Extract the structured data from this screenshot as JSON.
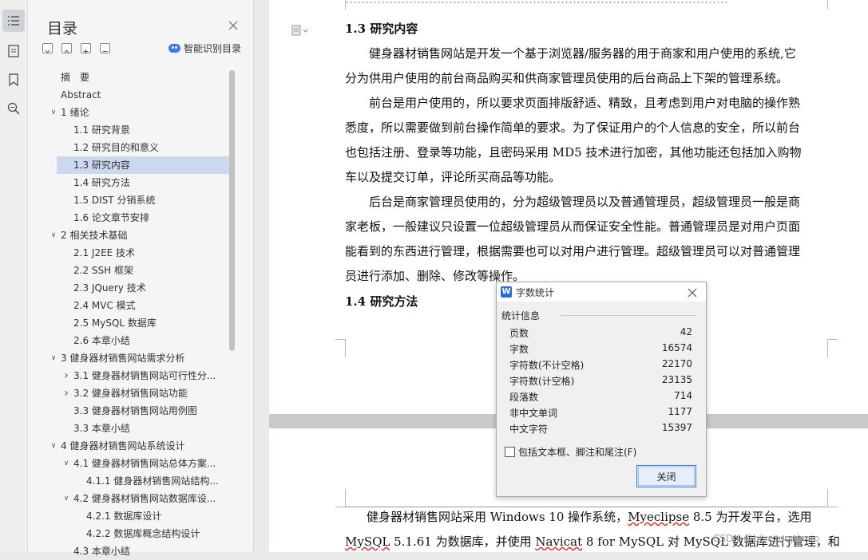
{
  "toc": {
    "title": "目录",
    "smart_label": "智能识别目录",
    "items": [
      {
        "text": "摘　要",
        "level": 0,
        "arrow": ""
      },
      {
        "text": "Abstract",
        "level": 0,
        "arrow": ""
      },
      {
        "text": "1 绪论",
        "level": 0,
        "arrow": "down"
      },
      {
        "text": "1.1 研究背景",
        "level": 1,
        "arrow": ""
      },
      {
        "text": "1.2 研究目的和意义",
        "level": 1,
        "arrow": ""
      },
      {
        "text": "1.3 研究内容",
        "level": 1,
        "arrow": "",
        "selected": true
      },
      {
        "text": "1.4 研究方法",
        "level": 1,
        "arrow": ""
      },
      {
        "text": "1.5 DIST 分销系统",
        "level": 1,
        "arrow": ""
      },
      {
        "text": "1.6 论文章节安排",
        "level": 1,
        "arrow": ""
      },
      {
        "text": "2 相关技术基础",
        "level": 0,
        "arrow": "down"
      },
      {
        "text": "2.1 J2EE 技术",
        "level": 1,
        "arrow": ""
      },
      {
        "text": "2.2 SSH 框架",
        "level": 1,
        "arrow": ""
      },
      {
        "text": "2.3 JQuery 技术",
        "level": 1,
        "arrow": ""
      },
      {
        "text": "2.4 MVC 模式",
        "level": 1,
        "arrow": ""
      },
      {
        "text": "2.5 MySQL 数据库",
        "level": 1,
        "arrow": ""
      },
      {
        "text": "2.6 本章小结",
        "level": 1,
        "arrow": ""
      },
      {
        "text": "3 健身器材销售网站需求分析",
        "level": 0,
        "arrow": "down"
      },
      {
        "text": "3.1 健身器材销售网站可行性分...",
        "level": 1,
        "arrow": "right"
      },
      {
        "text": "3.2 健身器材销售网站功能",
        "level": 1,
        "arrow": "right"
      },
      {
        "text": "3.3 健身器材销售网站用例图",
        "level": 1,
        "arrow": ""
      },
      {
        "text": "3.3 本章小结",
        "level": 1,
        "arrow": ""
      },
      {
        "text": "4 健身器材销售网站系统设计",
        "level": 0,
        "arrow": "down"
      },
      {
        "text": "4.1 健身器材销售网站总体方案...",
        "level": 1,
        "arrow": "down"
      },
      {
        "text": "4.1.1 健身器材销售网站结构...",
        "level": 2,
        "arrow": ""
      },
      {
        "text": "4.2 健身器材销售网站数据库设...",
        "level": 1,
        "arrow": "down"
      },
      {
        "text": "4.2.1 数据库设计",
        "level": 2,
        "arrow": ""
      },
      {
        "text": "4.2.2 数据库概念结构设计",
        "level": 2,
        "arrow": ""
      },
      {
        "text": "4.3 本章小结",
        "level": 1,
        "arrow": ""
      }
    ]
  },
  "doc": {
    "top_partial": "……………………………………………………………………………………",
    "heading1": "1.3  研究内容",
    "lines": [
      "健身器材销售网站是开发一个基于浏览器/服务器的用于商家和用户使用的系统,它",
      "分为供用户使用的前台商品购买和供商家管理员使用的后台商品上下架的管理系统。",
      "前台是用户使用的，所以要求页面排版舒适、精致，且考虑到用户对电脑的操作熟",
      "悉度，所以需要做到前台操作简单的要求。为了保证用户的个人信息的安全，所以前台",
      "也包括注册、登录等功能，且密码采用 MD5 技术进行加密，其他功能还包括加入购物",
      "车以及提交订单，评论所买商品等功能。",
      "后台是商家管理员使用的，分为超级管理员以及普通管理员，超级管理员一般是商",
      "家老板，一般建议只设置一位超级管理员从而保证安全性能。普通管理员是对用户页面",
      "能看到的东西进行管理，根据需要也可以对用户进行管理。超级管理员可以对普通管理",
      "员进行添加、删除、修改等操作。"
    ],
    "heading2": "1.4  研究方法",
    "page2_line1_a": "健身器材销售网站采用 Windows 10 操作系统，",
    "page2_line1_b": "Myeclipse",
    "page2_line1_c": " 8.5 为开发平台，选用",
    "page2_line2_a": "MySQL",
    "page2_line2_b": " 5.1.61 为数据库，并使用 ",
    "page2_line2_c": "Navicat",
    "page2_line2_d": " 8 for MySQL 对 MySQL 数据库进行管理，和"
  },
  "dialog": {
    "title": "字数统计",
    "group": "统计信息",
    "stats": [
      {
        "label": "页数",
        "value": "42"
      },
      {
        "label": "字数",
        "value": "16574"
      },
      {
        "label": "字符数(不计空格)",
        "value": "22170"
      },
      {
        "label": "字符数(计空格)",
        "value": "23135"
      },
      {
        "label": "段落数",
        "value": "714"
      },
      {
        "label": "非中文单词",
        "value": "1177"
      },
      {
        "label": "中文字符",
        "value": "15397"
      }
    ],
    "checkbox_label": "包括文本框、脚注和尾注(F)",
    "close_label": "关闭"
  },
  "watermark": "CSDN @biyezuopinvip"
}
